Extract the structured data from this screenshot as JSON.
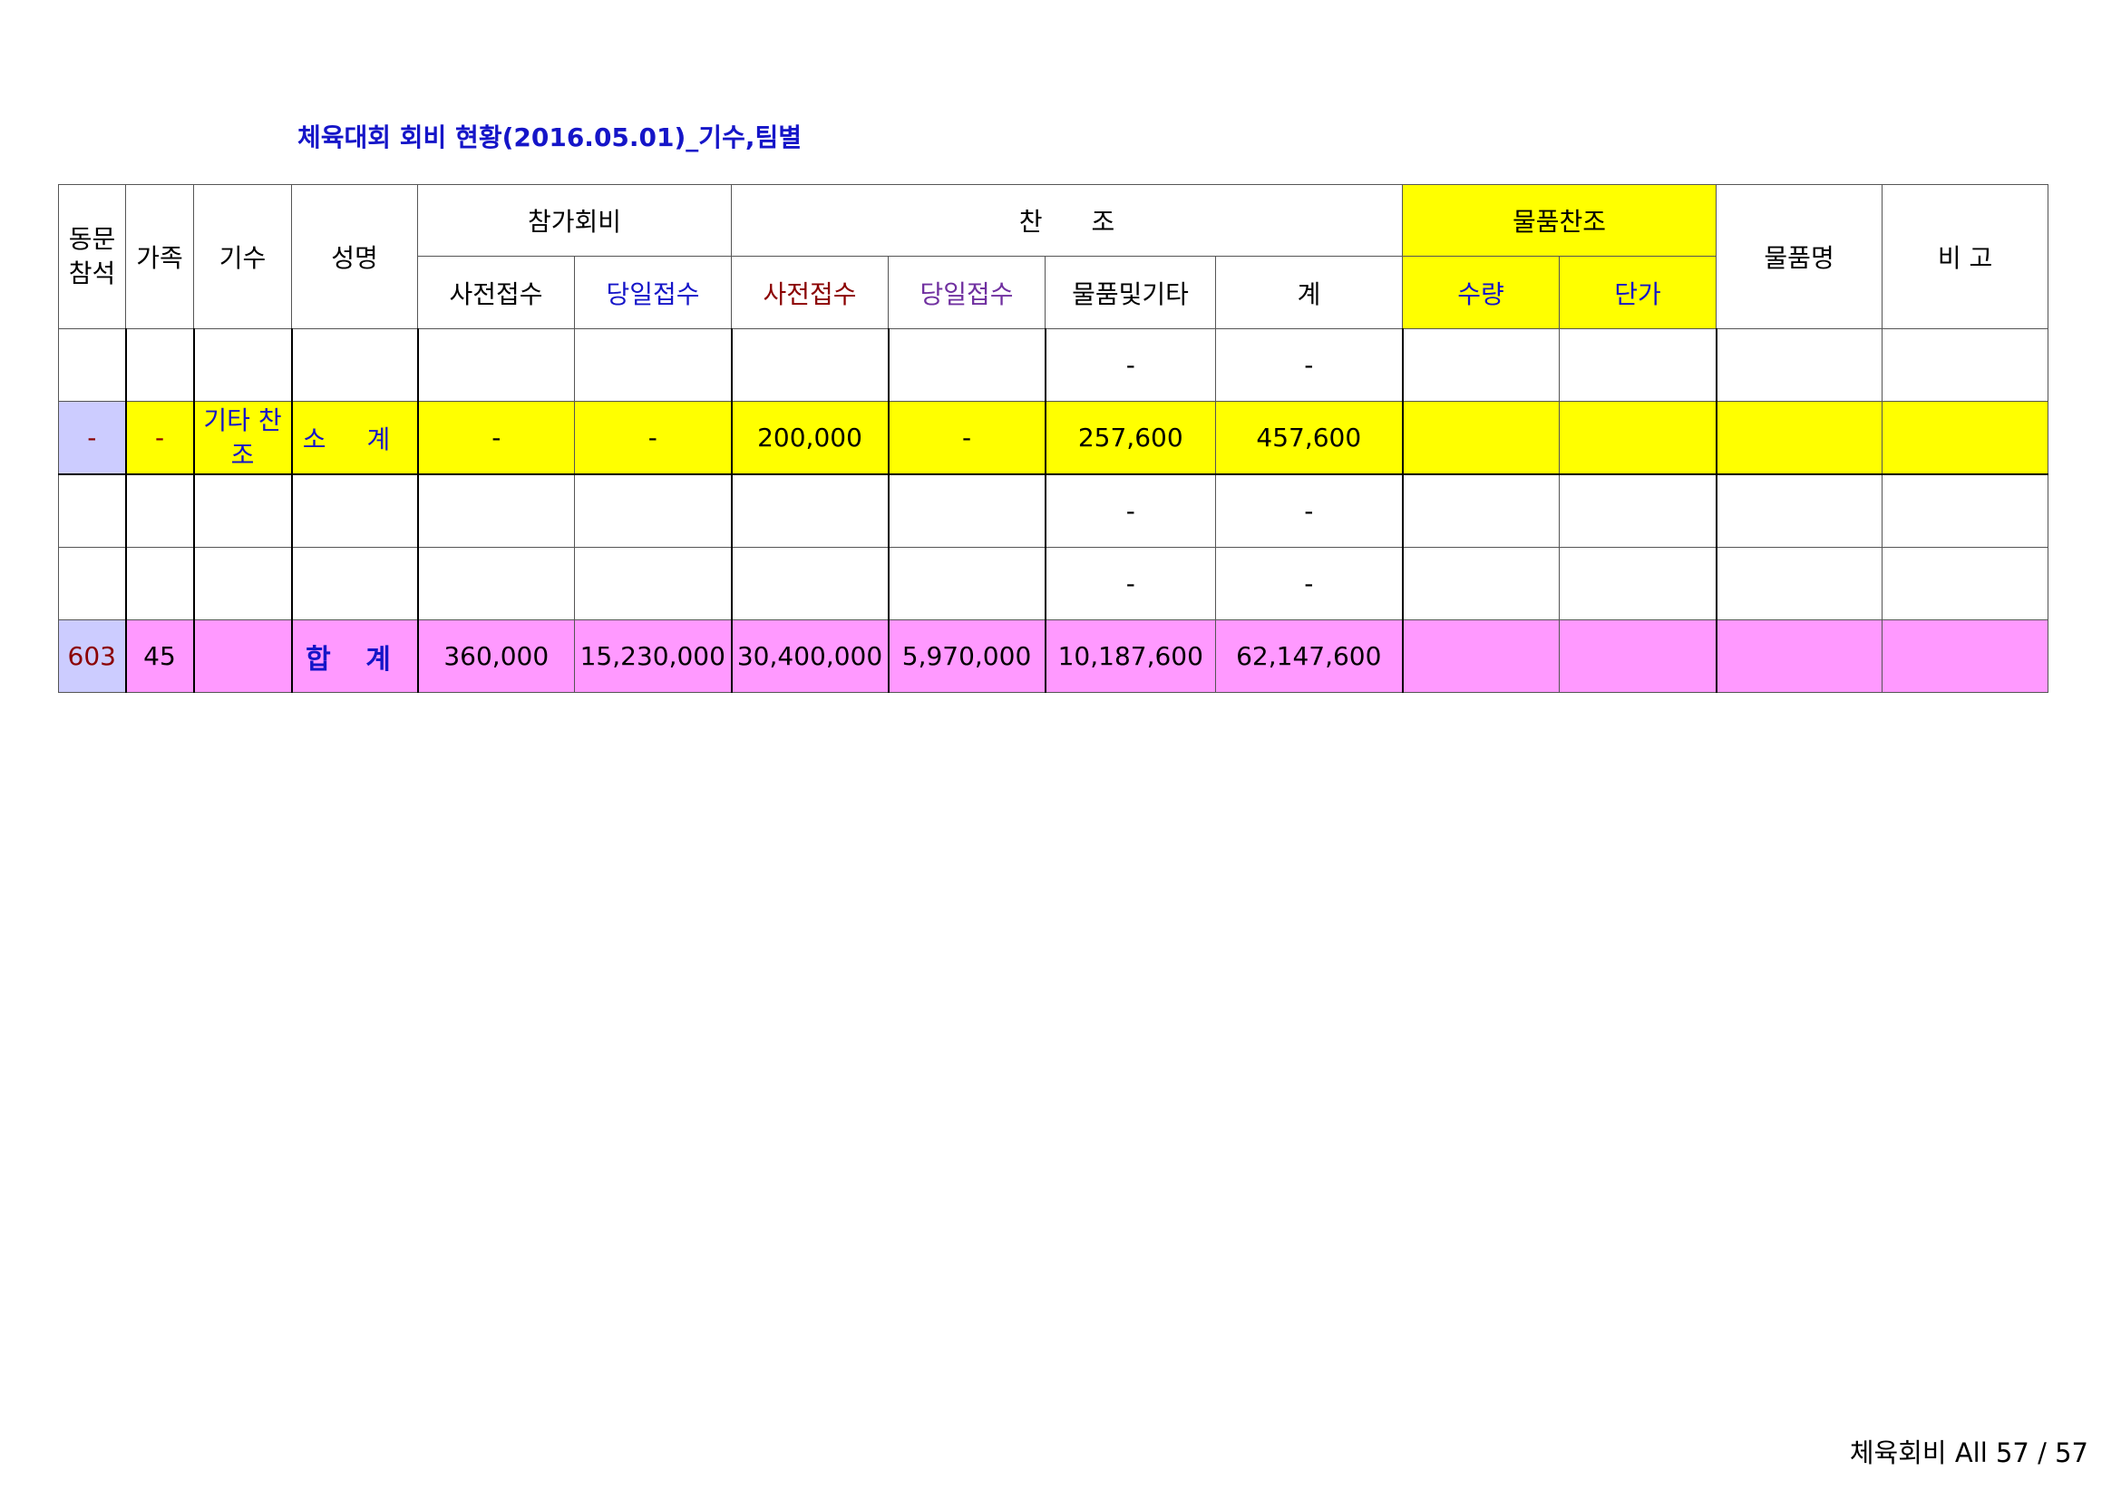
{
  "title": "체육대회 회비 현황(2016.05.01)_기수,팀별",
  "header": {
    "alumni_attend": "동문\n참석",
    "family": "가족",
    "class_year": "기수",
    "name": "성명",
    "participation_fee": "참가회비",
    "sponsorship_left": "찬",
    "sponsorship_right": "조",
    "goods_sponsorship": "물품찬조",
    "goods_name": "물품명",
    "remarks": "비 고",
    "fee_pre": "사전접수",
    "fee_same_day": "당일접수",
    "spon_pre": "사전접수",
    "spon_same_day": "당일접수",
    "spon_goods_etc": "물품및기타",
    "spon_total": "계",
    "quantity": "수량",
    "unit_price": "단가"
  },
  "rows": {
    "blank1": {
      "goods_etc": "-",
      "total": "-"
    },
    "subtotal": {
      "alumni": "-",
      "family": "-",
      "class_year": "기타\n찬조",
      "name": "소 계",
      "fee_pre": "-",
      "fee_same_day": "-",
      "spon_pre": "200,000",
      "spon_same_day": "-",
      "goods_etc": "257,600",
      "total": "457,600"
    },
    "blank2": {
      "goods_etc": "-",
      "total": "-"
    },
    "blank3": {
      "goods_etc": "-",
      "total": "-"
    },
    "grand_total": {
      "alumni": "603",
      "family": "45",
      "name": "합 계",
      "fee_pre": "360,000",
      "fee_same_day": "15,230,000",
      "spon_pre": "30,400,000",
      "spon_same_day": "5,970,000",
      "goods_etc": "10,187,600",
      "total": "62,147,600"
    }
  },
  "footer": "체육회비 All 57 / 57",
  "colors": {
    "title": "#1515c8",
    "goods_header": "#ffff00",
    "subtotal_row": "#ffff00",
    "alumni_cell": "#ccccff",
    "total_row": "#ff99ff"
  }
}
